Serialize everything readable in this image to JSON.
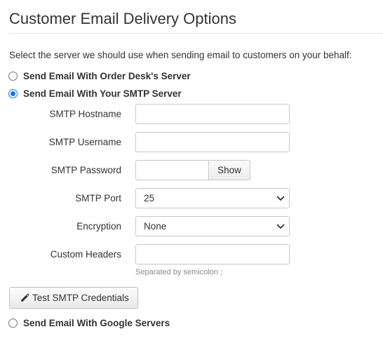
{
  "page": {
    "title": "Customer Email Delivery Options",
    "intro": "Select the server we should use when sending email to customers on your behalf:"
  },
  "options": {
    "orderdesk": {
      "label": "Send Email With Order Desk's Server",
      "checked": false
    },
    "smtp": {
      "label": "Send Email With Your SMTP Server",
      "checked": true
    },
    "google": {
      "label": "Send Email With Google Servers",
      "checked": false
    }
  },
  "smtp_form": {
    "hostname": {
      "label": "SMTP Hostname",
      "value": ""
    },
    "username": {
      "label": "SMTP Username",
      "value": ""
    },
    "password": {
      "label": "SMTP Password",
      "value": "",
      "show_button": "Show"
    },
    "port": {
      "label": "SMTP Port",
      "selected": "25"
    },
    "encryption": {
      "label": "Encryption",
      "selected": "None"
    },
    "headers": {
      "label": "Custom Headers",
      "value": "",
      "hint": "Separated by semicolon ;"
    }
  },
  "actions": {
    "test_button": "Test SMTP Credentials",
    "test_icon": "pencil-icon"
  },
  "colors": {
    "radio_accent": "#1a73e8",
    "text": "#333333",
    "hint": "#888888",
    "border": "#c7c7c7"
  }
}
